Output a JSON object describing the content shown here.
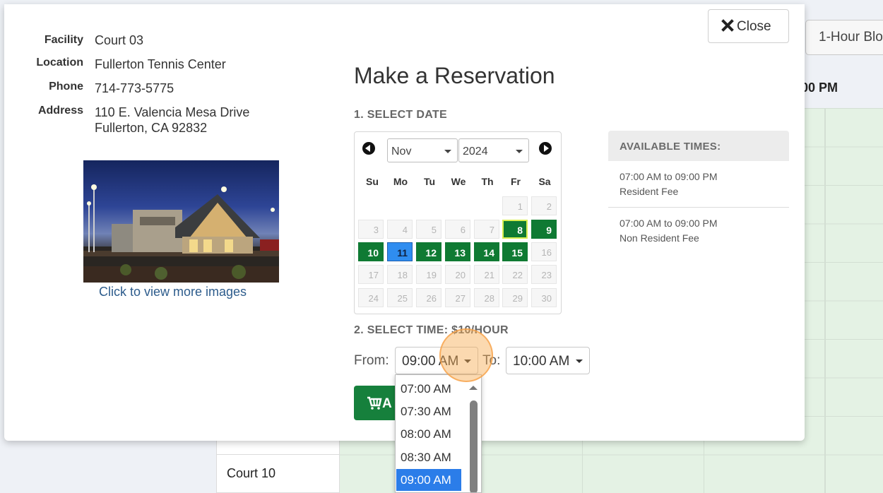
{
  "background": {
    "block_button_label": "1-Hour Blo",
    "time_header": ":00 PM",
    "row_label": "Court 10"
  },
  "modal": {
    "close_label": "Close",
    "facility": {
      "facility_label": "Facility",
      "facility_value": "Court 03",
      "location_label": "Location",
      "location_value": "Fullerton Tennis Center",
      "phone_label": "Phone",
      "phone_value": "714-773-5775",
      "address_label": "Address",
      "address_line1": "110 E. Valencia Mesa Drive",
      "address_line2": "Fullerton, CA 92832",
      "images_link": "Click to view more images"
    },
    "title": "Make a Reservation",
    "step1": "1. SELECT DATE",
    "calendar": {
      "month": "Nov",
      "year": "2024",
      "weekdays": [
        "Su",
        "Mo",
        "Tu",
        "We",
        "Th",
        "Fr",
        "Sa"
      ],
      "weeks": [
        [
          null,
          null,
          null,
          null,
          null,
          {
            "d": "1",
            "s": "disabled"
          },
          {
            "d": "2",
            "s": "disabled"
          }
        ],
        [
          {
            "d": "3",
            "s": "disabled"
          },
          {
            "d": "4",
            "s": "disabled"
          },
          {
            "d": "5",
            "s": "disabled"
          },
          {
            "d": "6",
            "s": "disabled"
          },
          {
            "d": "7",
            "s": "disabled"
          },
          {
            "d": "8",
            "s": "highlight"
          },
          {
            "d": "9",
            "s": "available"
          }
        ],
        [
          {
            "d": "10",
            "s": "available"
          },
          {
            "d": "11",
            "s": "selected"
          },
          {
            "d": "12",
            "s": "available"
          },
          {
            "d": "13",
            "s": "available"
          },
          {
            "d": "14",
            "s": "available"
          },
          {
            "d": "15",
            "s": "available"
          },
          {
            "d": "16",
            "s": "disabled"
          }
        ],
        [
          {
            "d": "17",
            "s": "disabled"
          },
          {
            "d": "18",
            "s": "disabled"
          },
          {
            "d": "19",
            "s": "disabled"
          },
          {
            "d": "20",
            "s": "disabled"
          },
          {
            "d": "21",
            "s": "disabled"
          },
          {
            "d": "22",
            "s": "disabled"
          },
          {
            "d": "23",
            "s": "disabled"
          }
        ],
        [
          {
            "d": "24",
            "s": "disabled"
          },
          {
            "d": "25",
            "s": "disabled"
          },
          {
            "d": "26",
            "s": "disabled"
          },
          {
            "d": "27",
            "s": "disabled"
          },
          {
            "d": "28",
            "s": "disabled"
          },
          {
            "d": "29",
            "s": "disabled"
          },
          {
            "d": "30",
            "s": "disabled"
          }
        ]
      ]
    },
    "available_times": {
      "heading": "AVAILABLE TIMES:",
      "slots": [
        {
          "range": "07:00 AM to 09:00 PM",
          "fee": "Resident Fee"
        },
        {
          "range": "07:00 AM to 09:00 PM",
          "fee": "Non Resident Fee"
        }
      ]
    },
    "step2": "2. SELECT TIME: $10/HOUR",
    "from_label": "From:",
    "from_value": "09:00 AM",
    "to_label": "To:",
    "to_value": "10:00 AM",
    "add_button_label": "A",
    "time_options": [
      "07:00 AM",
      "07:30 AM",
      "08:00 AM",
      "08:30 AM",
      "09:00 AM"
    ],
    "selected_time_option": "09:00 AM"
  },
  "colors": {
    "available": "#0f7a33",
    "selected": "#2f8df0",
    "highlight_border": "#d8ee4f",
    "dropdown_active": "#2b7de9"
  }
}
